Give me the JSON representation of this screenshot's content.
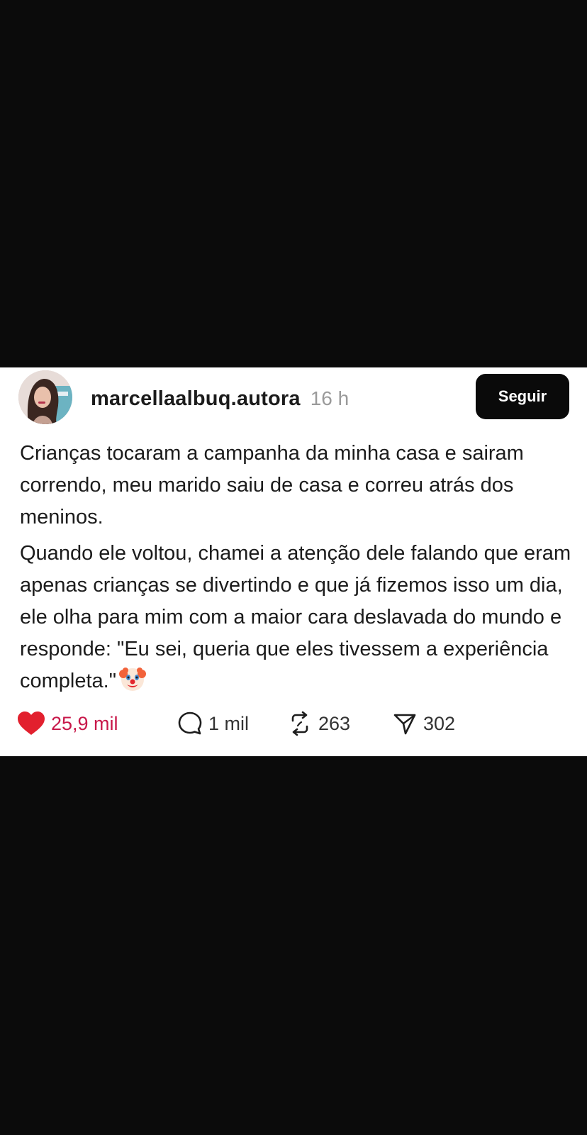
{
  "post": {
    "username": "marcellaalbuq.autora",
    "time": "16 h",
    "follow_label": "Seguir",
    "paragraphs": [
      "Crianças tocaram a campanha da minha casa e sairam correndo, meu marido saiu de casa e correu atrás dos meninos.",
      "Quando ele voltou, chamei a atenção dele falando que eram apenas crianças se divertindo e que já fizemos isso um dia,  ele olha para mim com a maior cara deslavada do mundo e responde: \"Eu sei, queria que eles tivessem a experiência completa.\""
    ],
    "emoji": "clown-face",
    "actions": {
      "likes": "25,9 mil",
      "comments": "1 mil",
      "reposts": "263",
      "shares": "302"
    }
  },
  "colors": {
    "background": "#0b0b0b",
    "card": "#ffffff",
    "like_accent": "#c8184a",
    "follow_button": "#0a0a0a"
  },
  "icons": [
    "avatar",
    "heart-icon",
    "comment-icon",
    "repost-icon",
    "share-icon",
    "clown-emoji"
  ]
}
